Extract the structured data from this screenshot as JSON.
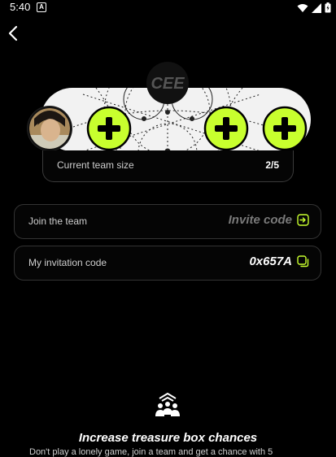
{
  "status_bar": {
    "time": "5:40",
    "app_badge": "A"
  },
  "team": {
    "logo_text": "CEE",
    "size_label": "Current team size",
    "size_value": "2/5"
  },
  "join": {
    "label": "Join the team",
    "placeholder": "Invite code"
  },
  "invitation": {
    "label": "My invitation code",
    "code": "0x657A"
  },
  "promo": {
    "title": "Increase treasure box chances",
    "subtitle": "Don't play a lonely game, join a team and get a chance with 5"
  },
  "colors": {
    "accent": "#c8ff2e",
    "background": "#000000"
  }
}
